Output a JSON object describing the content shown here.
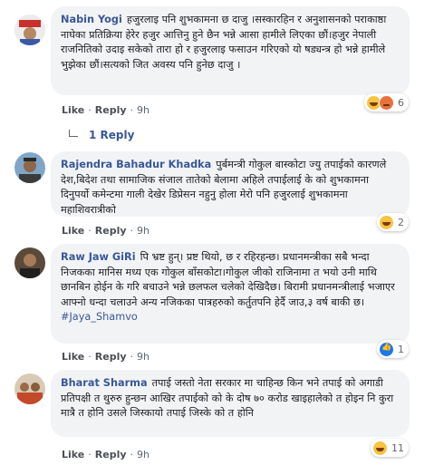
{
  "colors": {
    "link": "#385898",
    "bubble": "#f2f3f5",
    "meta": "#606770"
  },
  "comments": [
    {
      "author": "Nabin Yogi",
      "text": "हजुरलाइ पनि शुभकामना छ दाजु ।सस्कारहिन र अनुशासनको पराकाष्ठा नाघेका प्रतिक्रिया हेरेर हजुर आत्तिनु हुने छैन भन्ने आसा हामीले लिएका छौं।हजुर नेपाली राजनितिको उदाइ सकेको तारा हो र हजुरलाइ फसाउन गरिएको यो षड्यन्त्र हो भन्ने हामीले भुझेका छौं।सत्यको जित अवस्य पनि हुनेछ दाजु ।",
      "like": "Like",
      "reply": "Reply",
      "time": "9h",
      "reactions": [
        "haha-icon",
        "angry-icon"
      ],
      "reaction_count": "6"
    },
    {
      "author": "Rajendra Bahadur Khadka",
      "text": "पुर्बमन्त्री गोकुल बास्कोटा ज्यु तपाईको कारणले देश,बिदेश तथा सामाजिक संजाल तातेको बेलामा अहिले तपाईलाई के को शुभकामना दिनुपर्यो कमेन्टमा गाली देखेर डिप्रेसन नहुनु होला मेरो पनि हजुरलाई शुभकामना महाशिवरात्रीको",
      "like": "Like",
      "reply": "Reply",
      "time": "9h",
      "reactions": [
        "haha-icon"
      ],
      "reaction_count": "2"
    },
    {
      "author": "Raw Jaw GiRi",
      "text": "पि भ्रष्ट हुन्। प्रष्ट थियो, छ र रहिरहन्छ। प्रधानमन्त्रीका सबै भन्दा निजकका मानिस मध्य एक गोकुल बाँसकोटा।गोकुल जीको राजिनामा त भयो उनी माथि छानबिन होईन के गरि बचाउने भन्ने छलफल चलेको देखिदैछ। बिरामी प्रधानमन्त्रीलाई भजाएर आफ्नो धन्दा चलाउने अन्य नजिकका पात्रहरुको कर्तुतपनि हेर्दै जाउ,३ वर्ष बाकी छ।",
      "hashtag": "#Jaya_Shamvo",
      "like": "Like",
      "reply": "Reply",
      "time": "9h",
      "reactions": [
        "like-icon"
      ],
      "reaction_count": "1"
    },
    {
      "author": "Bharat Sharma",
      "text": "तपाई जस्तो नेता सरकार मा चाहिन्छ किन भने तपाई को अगाडी प्रतिपक्षी त थुरुरु हुन्छन आखिर तपाईको को के दोष ७० करोड खाइहालेको त होइन नि कुरा मात्रै त होनि उसले जिस्कायो तपाई जिस्के को त होनि",
      "like": "Like",
      "reply": "Reply",
      "time": "9h",
      "reactions": [
        "haha-icon"
      ],
      "reaction_count": "11"
    }
  ],
  "replies_link": "1 Reply",
  "avatars": [
    "avatar-nabin",
    "avatar-rajendra",
    "avatar-raw",
    "avatar-bharat"
  ]
}
